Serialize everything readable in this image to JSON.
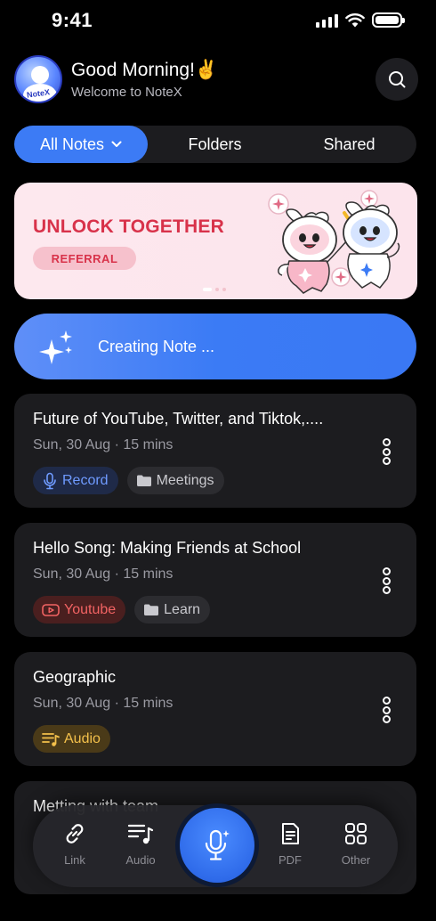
{
  "status_bar": {
    "time": "9:41"
  },
  "header": {
    "avatar_label": "NoteX",
    "greeting": "Good Morning!✌️",
    "subtitle": "Welcome to NoteX"
  },
  "tabs": [
    {
      "label": "All Notes",
      "active": true
    },
    {
      "label": "Folders",
      "active": false
    },
    {
      "label": "Shared",
      "active": false
    }
  ],
  "banner": {
    "title": "UNLOCK TOGETHER",
    "pill": "REFERRAL",
    "page_count": 3,
    "active_page": 1
  },
  "creating": {
    "label": "Creating Note ..."
  },
  "notes": [
    {
      "title": "Future of YouTube, Twitter, and Tiktok,....",
      "meta": "Sun, 30 Aug · 15 mins",
      "source": {
        "label": "Record",
        "icon": "mic-icon"
      },
      "folder": "Meetings"
    },
    {
      "title": "Hello Song: Making Friends at School",
      "meta": "Sun, 30 Aug · 15 mins",
      "source": {
        "label": "Youtube",
        "icon": "youtube-icon"
      },
      "folder": "Learn"
    },
    {
      "title": "Geographic",
      "meta": "Sun, 30 Aug · 15 mins",
      "source": {
        "label": "Audio",
        "icon": "audio-list-icon"
      },
      "folder": null
    }
  ],
  "partial_note": {
    "title": "Metting with team"
  },
  "dock": {
    "items": [
      {
        "label": "Link",
        "icon": "link-icon"
      },
      {
        "label": "Audio",
        "icon": "audio-list-icon"
      },
      {
        "label": "PDF",
        "icon": "pdf-icon"
      },
      {
        "label": "Other",
        "icon": "grid-icon"
      }
    ],
    "record_icon": "mic-sparkle-icon"
  },
  "colors": {
    "accent": "#3C7BF5",
    "banner_red": "#D8324A",
    "record_chip": "#6F9BFF",
    "youtube_chip": "#F26363",
    "audio_chip": "#F3C04B"
  }
}
